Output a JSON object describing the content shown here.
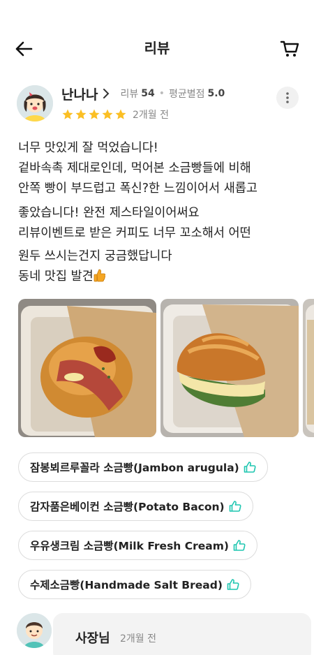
{
  "header": {
    "title": "리뷰"
  },
  "profile": {
    "name": "난나나",
    "review_label": "리뷰",
    "review_count": "54",
    "avg_label": "평균별점",
    "avg_score": "5.0",
    "rating": 5,
    "date": "2개월 전"
  },
  "review": {
    "lines": [
      "너무 맛있게 잘 먹었습니다!",
      "겉바속촉 제대로인데, 먹어본 소금빵들에 비해",
      "안쪽 빵이 부드럽고 폭신?한 느낌이어서 새롭고",
      " 좋았습니다! 완전 제스타일이어써요",
      "리뷰이벤트로 받은 커피도 너무 꼬소해서 어떤",
      "원두 쓰시는건지 궁금했답니다",
      "동네 맛집 발견"
    ]
  },
  "tags": [
    "잠봉뵈르루꼴라 소금빵(Jambon arugula)",
    "감자품은베이컨 소금빵(Potato Bacon)",
    "우유생크림 소금빵(Milk Fresh Cream)",
    "수제소금빵(Handmade Salt Bread)"
  ],
  "owner": {
    "name": "사장님",
    "date": "2개월 전"
  },
  "colors": {
    "star": "#fbbf24",
    "like_icon": "#1ec6b0"
  }
}
